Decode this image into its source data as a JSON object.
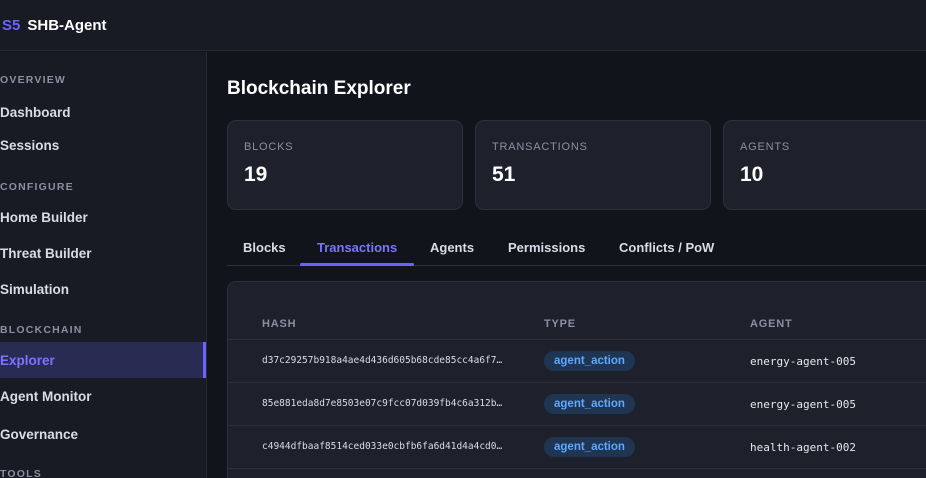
{
  "app": {
    "logo_mark": "S5",
    "name": "SHB-Agent"
  },
  "sidebar": {
    "sections": [
      {
        "title": "OVERVIEW",
        "items": [
          "Dashboard",
          "Sessions"
        ]
      },
      {
        "title": "CONFIGURE",
        "items": [
          "Home Builder",
          "Threat Builder",
          "Simulation"
        ]
      },
      {
        "title": "BLOCKCHAIN",
        "items": [
          "Explorer",
          "Agent Monitor",
          "Governance"
        ]
      },
      {
        "title": "TOOLS",
        "items": []
      }
    ],
    "active_item": "Explorer"
  },
  "page": {
    "title": "Blockchain Explorer"
  },
  "stats": [
    {
      "label": "BLOCKS",
      "value": "19"
    },
    {
      "label": "TRANSACTIONS",
      "value": "51"
    },
    {
      "label": "AGENTS",
      "value": "10"
    }
  ],
  "tabs": [
    "Blocks",
    "Transactions",
    "Agents",
    "Permissions",
    "Conflicts / PoW"
  ],
  "active_tab": "Transactions",
  "table": {
    "columns": [
      "HASH",
      "TYPE",
      "AGENT"
    ],
    "rows": [
      {
        "hash": "d37c29257b918a4ae4d436d605b68cde85cc4a6f7…",
        "type": "agent_action",
        "agent": "energy-agent-005"
      },
      {
        "hash": "85e881eda8d7e8503e07c9fcc07d039fb4c6a312b…",
        "type": "agent_action",
        "agent": "energy-agent-005"
      },
      {
        "hash": "c4944dfbaaf8514ced033e0cbfb6fa6d41d4a4cd0…",
        "type": "agent_action",
        "agent": "health-agent-002"
      }
    ]
  },
  "colors": {
    "accent": "#6c63ff",
    "badge_bg": "#1f3552",
    "badge_text": "#5fa8ff",
    "background": "#12141c",
    "panel": "#1e212c"
  }
}
